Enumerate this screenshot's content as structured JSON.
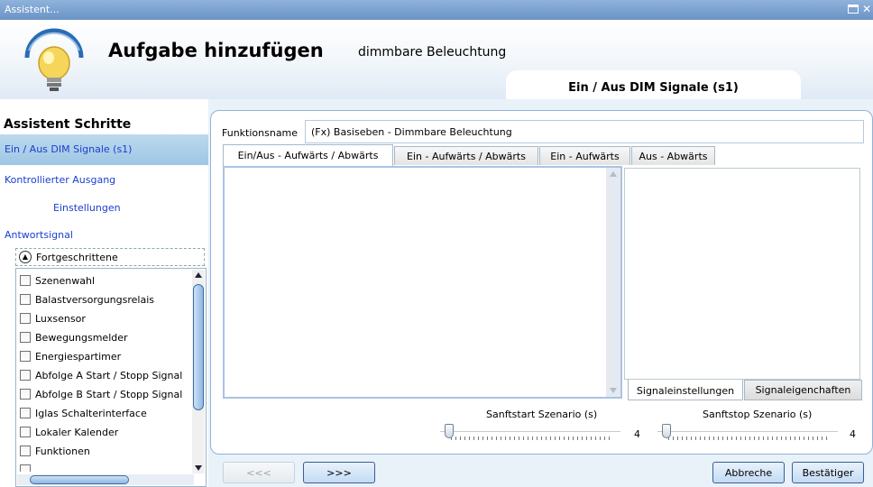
{
  "window": {
    "title": "Assistent..."
  },
  "header": {
    "title": "Aufgabe hinzufügen",
    "subtitle": "dimmbare Beleuchtung",
    "active_section": "Ein / Aus DIM Signale (s1)"
  },
  "sidebar": {
    "title": "Assistent Schritte",
    "steps": [
      {
        "label": "Ein / Aus DIM Signale (s1)",
        "active": true
      },
      {
        "label": "Kontrollierter Ausgang",
        "active": false
      },
      {
        "label": "Einstellungen",
        "active": false
      },
      {
        "label": "Antwortsignal",
        "active": false
      }
    ],
    "advanced_label": "Fortgeschrittene",
    "advanced_items": [
      "Szenenwahl",
      "Balastversorgungsrelais",
      "Luxsensor",
      "Bewegungsmelder",
      "Energiespartimer",
      "Abfolge A Start / Stopp Signal",
      "Abfolge B Start / Stopp Signal",
      "Iglas Schalterinterface",
      "Lokaler Kalender",
      "Funktionen"
    ]
  },
  "main": {
    "function_name_label": "Funktionsname",
    "function_name_value": "(Fx) Basiseben - Dimmbare Beleuchtung",
    "tabs": [
      {
        "label": "Ein/Aus - Aufwärts / Abwärts",
        "active": true
      },
      {
        "label": "Ein - Aufwärts / Abwärts",
        "active": false
      },
      {
        "label": "Ein - Aufwärts",
        "active": false
      },
      {
        "label": "Aus - Abwärts",
        "active": false
      }
    ],
    "bottom_tabs": [
      {
        "label": "Signaleinstellungen",
        "active": true
      },
      {
        "label": "Signaleigenchaften",
        "active": false
      }
    ],
    "softstart": {
      "label": "Sanftstart Szenario (s)",
      "value": "4"
    },
    "softstop": {
      "label": "Sanftstop Szenario (s)",
      "value": "4"
    }
  },
  "footer": {
    "prev_label": "<<<",
    "next_label": ">>>",
    "cancel_label": "Abbreche",
    "confirm_label": "Bestätiger"
  },
  "colors": {
    "accent": "#6a93c6",
    "link": "#1a3ecf",
    "active_step": "#bcd9ee"
  },
  "icons": [
    "lightbulb-icon",
    "collapse-chevron-icon",
    "window-restore-icon",
    "close-icon"
  ]
}
